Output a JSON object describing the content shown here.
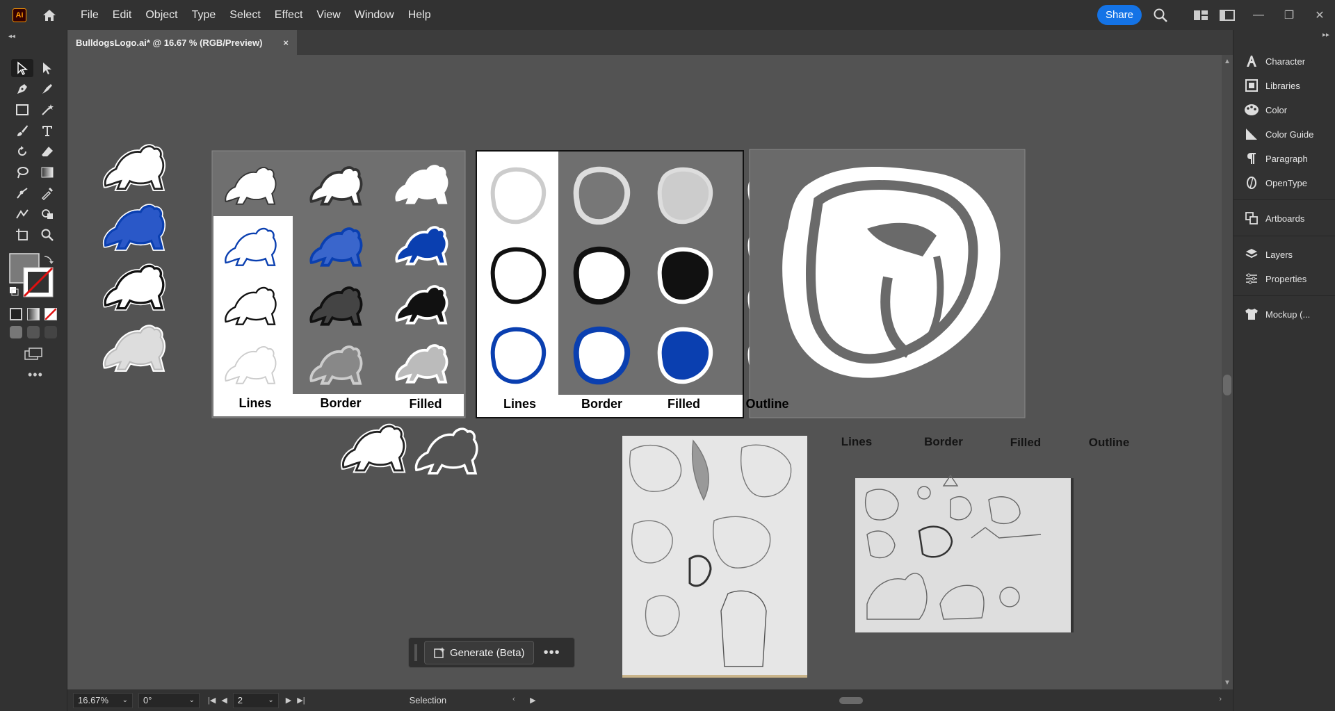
{
  "menubar": {
    "app_logo": "Ai",
    "menus": [
      "File",
      "Edit",
      "Object",
      "Type",
      "Select",
      "Effect",
      "View",
      "Window",
      "Help"
    ],
    "share_label": "Share"
  },
  "document": {
    "tab_title": "BulldogsLogo.ai* @ 16.67 % (RGB/Preview)",
    "close_glyph": "×"
  },
  "artboards": {
    "board1_labels": [
      "Lines",
      "Border",
      "Filled"
    ],
    "board2_labels": [
      "Lines",
      "Border",
      "Filled",
      "Outline"
    ],
    "free_labels": [
      "Lines",
      "Border",
      "Filled",
      "Outline"
    ]
  },
  "generate": {
    "label": "Generate (Beta)",
    "more": "•••"
  },
  "right_panel": {
    "items": [
      "Character",
      "Libraries",
      "Color",
      "Color Guide",
      "Paragraph",
      "OpenType",
      "Artboards",
      "Layers",
      "Properties",
      "Mockup (..."
    ]
  },
  "statusbar": {
    "zoom": "16.67%",
    "rotation": "0°",
    "artboard_number": "2",
    "tool": "Selection"
  },
  "colors": {
    "accent": "#1473e6",
    "bulldog_blue": "#0a3fb0",
    "canvas": "#535353",
    "chrome": "#323232"
  }
}
